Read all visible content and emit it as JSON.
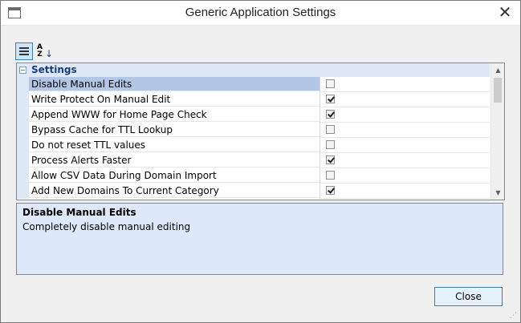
{
  "window": {
    "title": "Generic Application Settings",
    "close_glyph": "✕"
  },
  "toolbar": {
    "categorized_icon": "categorized-view-icon",
    "alphabetical_icon": "alphabetical-sort-icon",
    "az_text": "A\nZ",
    "az_arrow": "↓"
  },
  "grid": {
    "category": {
      "label": "Settings",
      "toggle": "−"
    },
    "properties": [
      {
        "label": "Disable Manual Edits",
        "checked": false,
        "selected": true
      },
      {
        "label": "Write Protect On Manual Edit",
        "checked": true,
        "selected": false
      },
      {
        "label": "Append WWW for Home Page Check",
        "checked": true,
        "selected": false
      },
      {
        "label": "Bypass Cache for TTL Lookup",
        "checked": false,
        "selected": false
      },
      {
        "label": "Do not reset TTL values",
        "checked": false,
        "selected": false
      },
      {
        "label": "Process Alerts Faster",
        "checked": true,
        "selected": false
      },
      {
        "label": "Allow CSV Data During Domain Import",
        "checked": false,
        "selected": false
      },
      {
        "label": "Add New Domains To Current Category",
        "checked": true,
        "selected": false
      }
    ],
    "scroll_up": "▲",
    "scroll_down": "▼"
  },
  "description": {
    "title": "Disable Manual Edits",
    "text": "Completely disable manual editing"
  },
  "footer": {
    "close_label": "Close",
    "grip_glyph": "⋰"
  }
}
